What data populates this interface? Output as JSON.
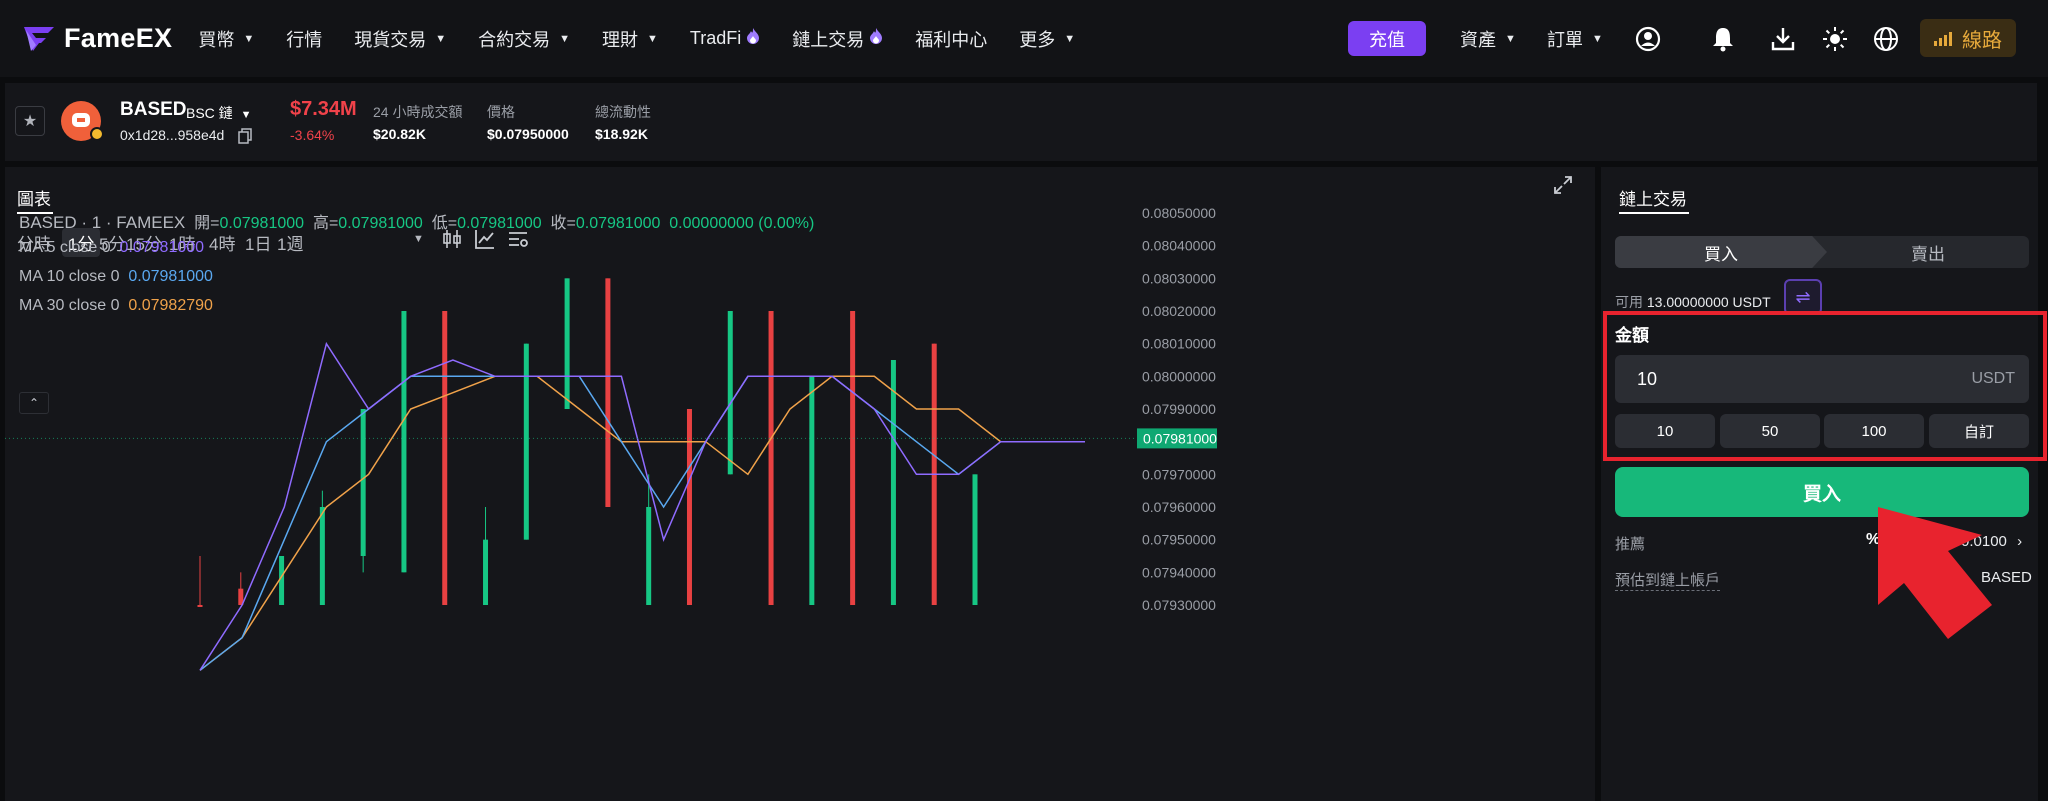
{
  "brand": {
    "name": "FameEX"
  },
  "nav": {
    "items": [
      {
        "label": "買幣",
        "dropdown": true
      },
      {
        "label": "行情",
        "dropdown": false
      },
      {
        "label": "現貨交易",
        "dropdown": true
      },
      {
        "label": "合約交易",
        "dropdown": true
      },
      {
        "label": "理財",
        "dropdown": true
      },
      {
        "label": "TradFi",
        "hot": true
      },
      {
        "label": "鏈上交易",
        "hot": true
      },
      {
        "label": "福利中心",
        "dropdown": false
      },
      {
        "label": "更多",
        "dropdown": true
      }
    ],
    "deposit": "充值",
    "assets": "資產",
    "orders": "訂單",
    "line": "線路",
    "icons": [
      "user-icon",
      "bell-icon",
      "download-icon",
      "sun-icon",
      "globe-icon",
      "signal-icon"
    ]
  },
  "token": {
    "name": "BASED",
    "chain": "BSC 鏈",
    "address": "0x1d28...958e4d",
    "market_cap": "$7.34M",
    "change": "-3.64%",
    "stats": [
      {
        "label": "24 小時成交額",
        "value": "$20.82K"
      },
      {
        "label": "價格",
        "value": "$0.07950000"
      },
      {
        "label": "總流動性",
        "value": "$18.92K"
      }
    ]
  },
  "chart": {
    "tab": "圖表",
    "timeframes": [
      "分時",
      "1分",
      "5分",
      "15分",
      "1時",
      "4時",
      "1日",
      "1週"
    ],
    "active_timeframe": "1分",
    "legend": {
      "symbol": "BASED · 1 · FAMEEX",
      "o_label": "開=",
      "o": "0.07981000",
      "h_label": "高=",
      "h": "0.07981000",
      "l_label": "低=",
      "l": "0.07981000",
      "c_label": "收=",
      "c": "0.07981000",
      "chg": "0.00000000 (0.00%)",
      "ma5_label": "MA 5 close 0",
      "ma5": "0.07981000",
      "ma10_label": "MA 10 close 0",
      "ma10": "0.07981000",
      "ma30_label": "MA 30 close 0",
      "ma30": "0.07982790"
    },
    "price_tag": "0.07981000",
    "colors": {
      "up": "#16c784",
      "down": "#e84142",
      "ma5": "#8f6bff",
      "ma10": "#5aa8f0",
      "ma30": "#f0a24a"
    }
  },
  "chart_data": {
    "type": "candlestick",
    "y_ticks": [
      "0.08050000",
      "0.08040000",
      "0.08030000",
      "0.08020000",
      "0.08010000",
      "0.08000000",
      "0.07990000",
      "0.07980000",
      "0.07970000",
      "0.07960000",
      "0.07950000",
      "0.07940000",
      "0.07930000"
    ],
    "ylim": [
      0.0793,
      0.0805
    ],
    "candles": [
      {
        "o": 0.0793,
        "h": 0.07945,
        "l": 0.0792,
        "c": 0.0792
      },
      {
        "o": 0.07935,
        "h": 0.0794,
        "l": 0.0792,
        "c": 0.0792
      },
      {
        "o": 0.0792,
        "h": 0.07945,
        "l": 0.0792,
        "c": 0.07945
      },
      {
        "o": 0.0793,
        "h": 0.07965,
        "l": 0.0793,
        "c": 0.0796
      },
      {
        "o": 0.07945,
        "h": 0.07985,
        "l": 0.0794,
        "c": 0.0799
      },
      {
        "o": 0.0794,
        "h": 0.0802,
        "l": 0.0794,
        "c": 0.0802
      },
      {
        "o": 0.0802,
        "h": 0.0802,
        "l": 0.0792,
        "c": 0.0792
      },
      {
        "o": 0.0793,
        "h": 0.0796,
        "l": 0.0792,
        "c": 0.0795
      },
      {
        "o": 0.0795,
        "h": 0.0801,
        "l": 0.0795,
        "c": 0.0801
      },
      {
        "o": 0.0799,
        "h": 0.0803,
        "l": 0.0799,
        "c": 0.0803
      },
      {
        "o": 0.0803,
        "h": 0.0803,
        "l": 0.0796,
        "c": 0.0796
      },
      {
        "o": 0.0793,
        "h": 0.0797,
        "l": 0.0792,
        "c": 0.0796
      },
      {
        "o": 0.0799,
        "h": 0.0799,
        "l": 0.0793,
        "c": 0.0793
      },
      {
        "o": 0.0797,
        "h": 0.0802,
        "l": 0.0797,
        "c": 0.0802
      },
      {
        "o": 0.0802,
        "h": 0.0802,
        "l": 0.0791,
        "c": 0.0791
      },
      {
        "o": 0.0792,
        "h": 0.08,
        "l": 0.0792,
        "c": 0.08
      },
      {
        "o": 0.0802,
        "h": 0.0802,
        "l": 0.0792,
        "c": 0.0792
      },
      {
        "o": 0.0792,
        "h": 0.08005,
        "l": 0.0792,
        "c": 0.08005
      },
      {
        "o": 0.0801,
        "h": 0.0801,
        "l": 0.0791,
        "c": 0.0791
      },
      {
        "o": 0.0792,
        "h": 0.0797,
        "l": 0.0792,
        "c": 0.0797
      }
    ],
    "last_price": 0.07981,
    "ma5": [
      0.0791,
      0.0793,
      0.0796,
      0.0801,
      0.0799,
      0.08,
      0.08005,
      0.08,
      0.08,
      0.08,
      0.08,
      0.0795,
      0.0798,
      0.08,
      0.08,
      0.08,
      0.0799,
      0.0797,
      0.0797,
      0.0798,
      0.0798,
      0.0798
    ],
    "ma10": [
      0.0791,
      0.0792,
      0.0795,
      0.0798,
      0.0799,
      0.08,
      0.08,
      0.08,
      0.08,
      0.08,
      0.0798,
      0.0796,
      0.0798,
      0.08,
      0.08,
      0.08,
      0.0799,
      0.0798,
      0.0797,
      0.0798,
      0.0798,
      0.0798
    ],
    "ma30": [
      0.0791,
      0.0792,
      0.0794,
      0.0796,
      0.0797,
      0.0799,
      0.07995,
      0.08,
      0.08,
      0.0799,
      0.0798,
      0.0798,
      0.0798,
      0.0797,
      0.0799,
      0.08,
      0.08,
      0.0799,
      0.0799,
      0.0798,
      0.0798,
      0.0798
    ]
  },
  "trade": {
    "tab": "鏈上交易",
    "buy": "買入",
    "sell": "賣出",
    "available_label": "可用",
    "available_value": "13.00000000 USDT",
    "amount_label": "金額",
    "amount_value": "10",
    "amount_unit": "USDT",
    "presets": [
      "10",
      "50",
      "100",
      "自訂"
    ],
    "submit": "買入",
    "slippage_label": "推薦",
    "slippage_pct": "%",
    "slippage_value": "0.0100",
    "estimate_label": "預估到鏈上帳戶",
    "estimate_value": "BASED"
  }
}
